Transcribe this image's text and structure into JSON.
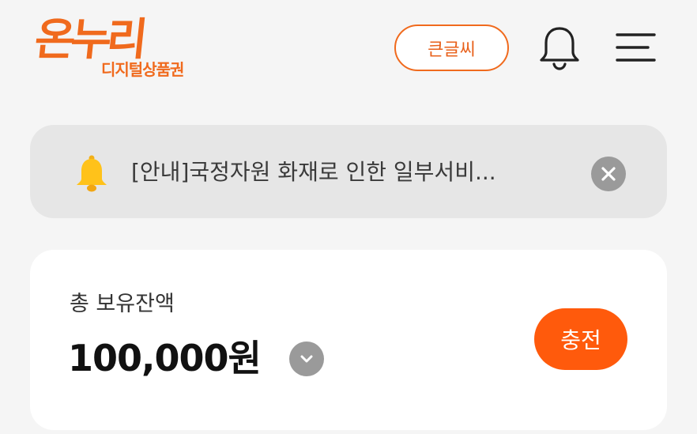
{
  "header": {
    "logo_main": "온누리",
    "logo_sub": "디지털상품권",
    "bigtext_label": "큰글씨",
    "bell_icon": "bell-icon",
    "menu_icon": "hamburger-menu-icon"
  },
  "notice": {
    "icon": "bell-icon",
    "text": "[안내]국정자원 화재로 인한 일부서비...",
    "close_icon": "close-icon"
  },
  "balance": {
    "label": "총 보유잔액",
    "amount": "100,000원",
    "toggle_icon": "chevron-down-icon",
    "charge_label": "충전"
  },
  "colors": {
    "brand_orange": "#f06a1d",
    "charge_orange": "#ff5a0c",
    "background": "#f5f5f5",
    "notice_bg": "#e6e6e6",
    "bell_yellow": "#ffc21a"
  }
}
